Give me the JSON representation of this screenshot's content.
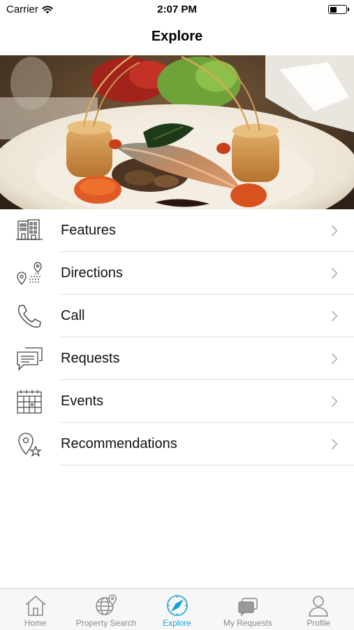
{
  "status_bar": {
    "carrier": "Carrier",
    "time": "2:07 PM",
    "battery_level": 0.45
  },
  "header": {
    "title": "Explore"
  },
  "hero": {
    "icon": "plated-fish-dish-photo"
  },
  "menu": [
    {
      "label": "Features",
      "icon": "building-icon"
    },
    {
      "label": "Directions",
      "icon": "route-pin-icon"
    },
    {
      "label": "Call",
      "icon": "phone-icon"
    },
    {
      "label": "Requests",
      "icon": "chat-bubbles-icon"
    },
    {
      "label": "Events",
      "icon": "calendar-icon"
    },
    {
      "label": "Recommendations",
      "icon": "pin-star-icon"
    }
  ],
  "tab_bar": {
    "active_color": "#1a9fd9",
    "inactive_color": "#8a8a8a",
    "tabs": [
      {
        "label": "Home",
        "icon": "home-icon"
      },
      {
        "label": "Property Search",
        "icon": "globe-pin-icon"
      },
      {
        "label": "Explore",
        "icon": "compass-icon",
        "active": true
      },
      {
        "label": "My Requests",
        "icon": "cards-icon"
      },
      {
        "label": "Profile",
        "icon": "person-icon"
      }
    ]
  }
}
